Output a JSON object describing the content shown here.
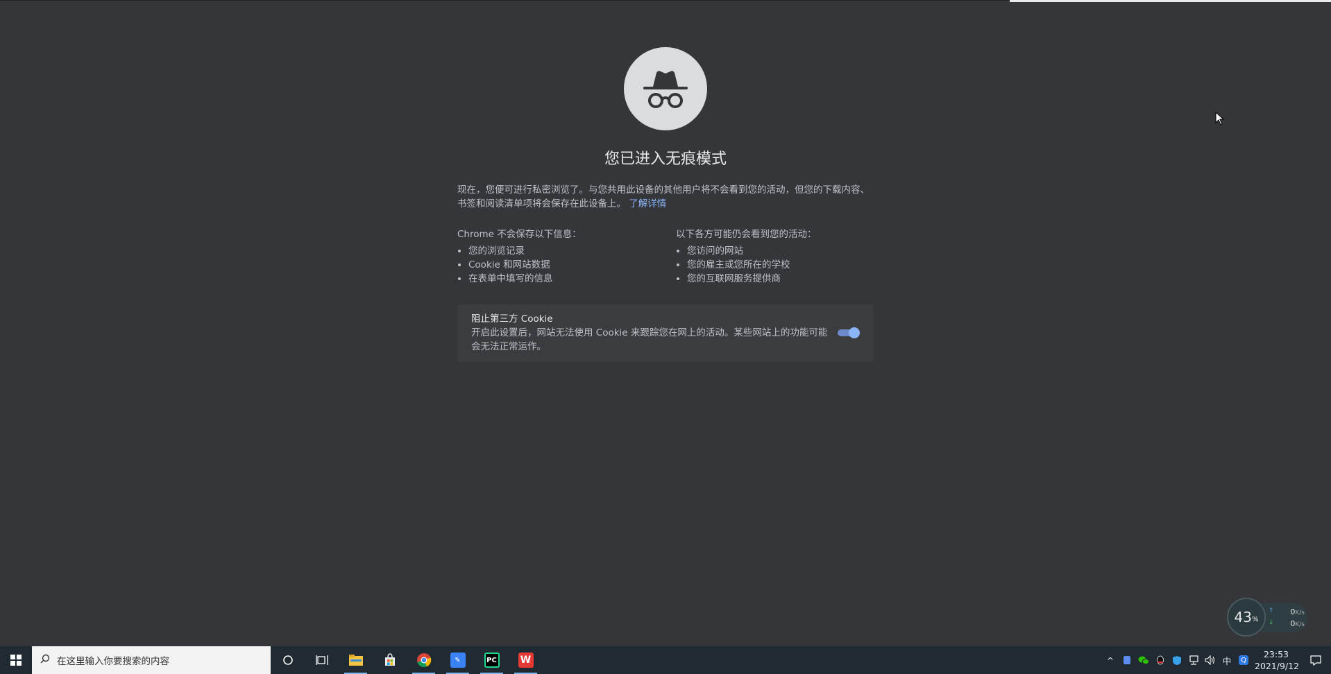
{
  "incognito": {
    "title": "您已进入无痕模式",
    "intro": "现在，您便可进行私密浏览了。与您共用此设备的其他用户将不会看到您的活动，但您的下载内容、书签和阅读清单项将会保存在此设备上。",
    "learn_more": "了解详情",
    "not_saved": {
      "heading": "Chrome 不会保存以下信息：",
      "items": [
        "您的浏览记录",
        "Cookie 和网站数据",
        "在表单中填写的信息"
      ]
    },
    "visible_to": {
      "heading": "以下各方可能仍会看到您的活动：",
      "items": [
        "您访问的网站",
        "您的雇主或您所在的学校",
        "您的互联网服务提供商"
      ]
    },
    "cookie_card": {
      "title": "阻止第三方 Cookie",
      "description": "开启此设置后，网站无法使用 Cookie 来跟踪您在网上的活动。某些网站上的功能可能会无法正常运作。",
      "enabled": true
    }
  },
  "net_monitor": {
    "percent": "43",
    "percent_unit": "%",
    "upload": "0",
    "download": "0",
    "unit": "K/s"
  },
  "taskbar": {
    "search_placeholder": "在这里输入你要搜索的内容",
    "apps": [
      "cortana-icon",
      "task-view-icon",
      "file-explorer-icon",
      "store-icon",
      "chrome-icon",
      "feishu-icon",
      "pycharm-icon",
      "wps-icon"
    ],
    "pycharm_label": "PC",
    "ime": "中",
    "time": "23:53",
    "date": "2021/9/12"
  },
  "colors": {
    "page_bg": "#35363a",
    "link": "#8ab4f8",
    "toggle": "#8ab4f8",
    "taskbar": "#1f2a32"
  }
}
